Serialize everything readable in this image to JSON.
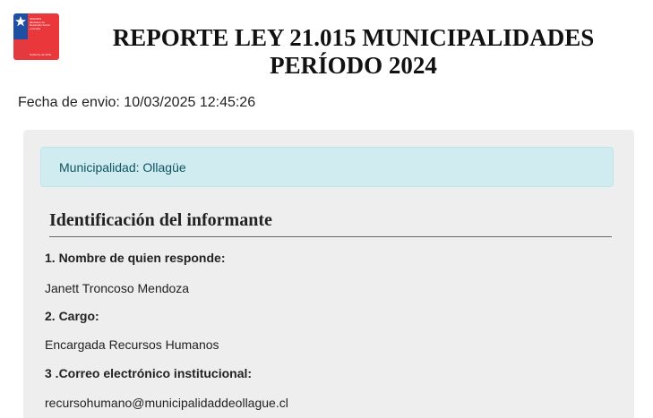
{
  "header": {
    "logo_icon": "gobierno-de-chile-senadis-logo",
    "logo_text": [
      "SENADIS",
      "Ministerio de",
      "Desarrollo Social",
      "y Familia"
    ],
    "logo_subtext": "Gobierno de Chile",
    "title_line1": "REPORTE LEY 21.015 MUNICIPALIDADES",
    "title_line2": "PERÍODO 2024"
  },
  "submission": {
    "date_text": "Fecha de envio: 10/03/2025 12:45:26"
  },
  "panel": {
    "municipality_text": "Municipalidad: Ollagüe",
    "section_title": "Identificación del informante",
    "questions": [
      {
        "label": "1. Nombre de quien responde:",
        "answer": "Janett Troncoso Mendoza"
      },
      {
        "label": "2. Cargo:",
        "answer": "Encargada Recursos Humanos"
      },
      {
        "label": "3 .Correo electrónico institucional:",
        "answer": "recursohumano@municipalidaddeollague.cl"
      }
    ]
  },
  "colors": {
    "logo_blue": "#1f4fa3",
    "logo_red": "#e9373c",
    "panel_background": "#eeeeee",
    "alert_background": "#d1ecf1",
    "alert_text": "#0c5460"
  }
}
